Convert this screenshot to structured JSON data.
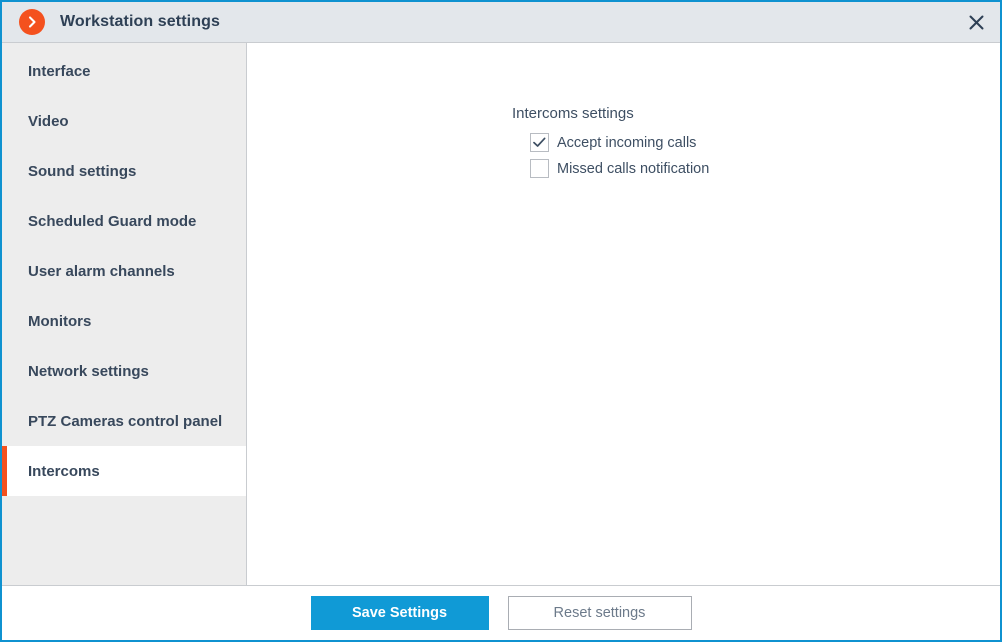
{
  "window": {
    "title": "Workstation settings",
    "app_icon": "chevron-right-circle-icon",
    "close_icon": "close-icon",
    "border_color": "#0f92d0",
    "titlebar_bg": "#e3e7eb",
    "accent_color": "#f4511e"
  },
  "sidebar": {
    "bg": "#ededed",
    "selected_index": 8,
    "items": [
      {
        "label": "Interface"
      },
      {
        "label": "Video"
      },
      {
        "label": "Sound settings"
      },
      {
        "label": "Scheduled Guard mode"
      },
      {
        "label": "User alarm channels"
      },
      {
        "label": "Monitors"
      },
      {
        "label": "Network settings"
      },
      {
        "label": "PTZ Cameras control panel"
      },
      {
        "label": "Intercoms"
      }
    ]
  },
  "content": {
    "section_title": "Intercoms settings",
    "checkboxes": [
      {
        "label": "Accept incoming calls",
        "checked": true,
        "icon": "check-icon"
      },
      {
        "label": "Missed calls notification",
        "checked": false,
        "icon": ""
      }
    ]
  },
  "footer": {
    "save_label": "Save Settings",
    "reset_label": "Reset settings",
    "save_color": "#109ad6"
  }
}
